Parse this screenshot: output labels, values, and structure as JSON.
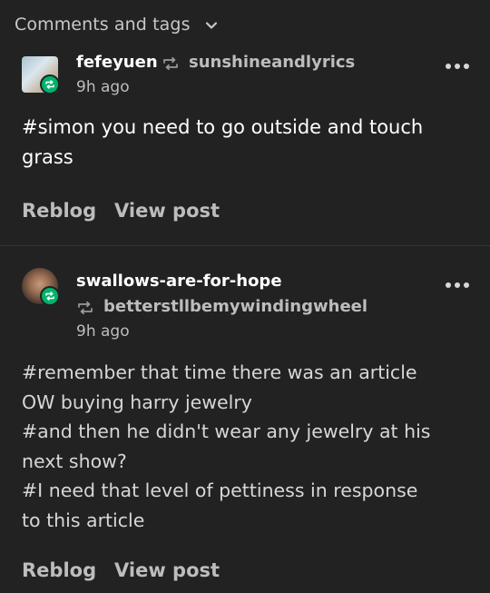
{
  "header": {
    "title": "Comments and tags",
    "chevron_icon": "chevron-down-icon"
  },
  "comments": [
    {
      "username": "fefeyuen",
      "reblogged_from": "sunshineandlyrics",
      "time": "9h ago",
      "text_lines": [
        "#simon you need to go outside and touch",
        "grass"
      ],
      "actions": {
        "reblog": "Reblog",
        "view_post": "View post"
      }
    },
    {
      "username": "swallows-are-for-hope",
      "reblogged_from": "betterstllbemywindingwheel",
      "time": "9h ago",
      "text_lines": [
        "#remember that time there was an article",
        "OW buying harry jewelry",
        "#and then he didn't wear any jewelry at his",
        "next show?",
        "#I need that level of pettiness in response",
        "to this article"
      ],
      "actions": {
        "reblog": "Reblog",
        "view_post": "View post"
      }
    }
  ],
  "colors": {
    "background": "#222222",
    "text": "#ffffff",
    "muted": "#bdbdbd",
    "reblog_green": "#00b36b"
  }
}
